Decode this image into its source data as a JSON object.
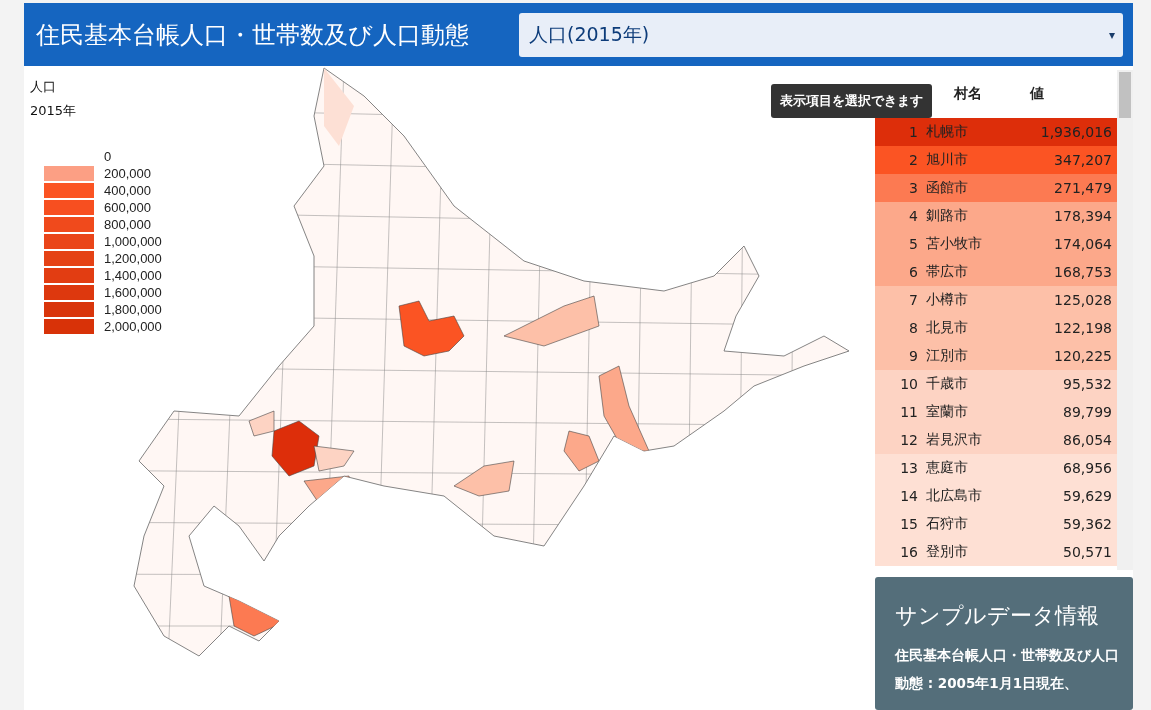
{
  "header": {
    "title": "住民基本台帳人口・世帯数及び人口動態",
    "select": {
      "value": "人口(2015年)",
      "caret": "▾"
    }
  },
  "legend": {
    "title": "人口",
    "subtitle": "2015年",
    "items": [
      {
        "label": "0"
      },
      {
        "label": "200,000",
        "color": "#fc9f84"
      },
      {
        "label": "400,000",
        "color": "#fb5423"
      },
      {
        "label": "600,000",
        "color": "#f74f20"
      },
      {
        "label": "800,000",
        "color": "#f04a1c"
      },
      {
        "label": "1,000,000",
        "color": "#ea4519"
      },
      {
        "label": "1,200,000",
        "color": "#e54215"
      },
      {
        "label": "1,400,000",
        "color": "#e23d12"
      },
      {
        "label": "1,600,000",
        "color": "#dd380e"
      },
      {
        "label": "1,800,000",
        "color": "#d9350b"
      },
      {
        "label": "2,000,000",
        "color": "#d83208"
      }
    ]
  },
  "tooltip": "表示項目を選択できます",
  "table": {
    "columns": [
      "村名",
      "値"
    ],
    "rows": [
      {
        "rank": "1",
        "name": "札幌市",
        "value": "1,936,016",
        "color": "#dd2e0a"
      },
      {
        "rank": "2",
        "name": "旭川市",
        "value": "347,207",
        "color": "#fb5423"
      },
      {
        "rank": "3",
        "name": "函館市",
        "value": "271,479",
        "color": "#fc7a52"
      },
      {
        "rank": "4",
        "name": "釧路市",
        "value": "178,394",
        "color": "#fca88a"
      },
      {
        "rank": "5",
        "name": "苫小牧市",
        "value": "174,064",
        "color": "#fca88a"
      },
      {
        "rank": "6",
        "name": "帯広市",
        "value": "168,753",
        "color": "#fca88a"
      },
      {
        "rank": "7",
        "name": "小樽市",
        "value": "125,028",
        "color": "#fdc0a8"
      },
      {
        "rank": "8",
        "name": "北見市",
        "value": "122,198",
        "color": "#fdc0a8"
      },
      {
        "rank": "9",
        "name": "江別市",
        "value": "120,225",
        "color": "#fdc0a8"
      },
      {
        "rank": "10",
        "name": "千歳市",
        "value": "95,532",
        "color": "#fdd3c3"
      },
      {
        "rank": "11",
        "name": "室蘭市",
        "value": "89,799",
        "color": "#fdd3c3"
      },
      {
        "rank": "12",
        "name": "岩見沢市",
        "value": "86,054",
        "color": "#fdd3c3"
      },
      {
        "rank": "13",
        "name": "恵庭市",
        "value": "68,956",
        "color": "#fee0d4"
      },
      {
        "rank": "14",
        "name": "北広島市",
        "value": "59,629",
        "color": "#fee0d4"
      },
      {
        "rank": "15",
        "name": "石狩市",
        "value": "59,362",
        "color": "#fee0d4"
      },
      {
        "rank": "16",
        "name": "登別市",
        "value": "50,571",
        "color": "#fee0d4"
      }
    ]
  },
  "info": {
    "title": "サンプルデータ情報",
    "text": "住民基本台帳人口・世帯数及び人口動態 : 2005年1月1日現在、"
  }
}
